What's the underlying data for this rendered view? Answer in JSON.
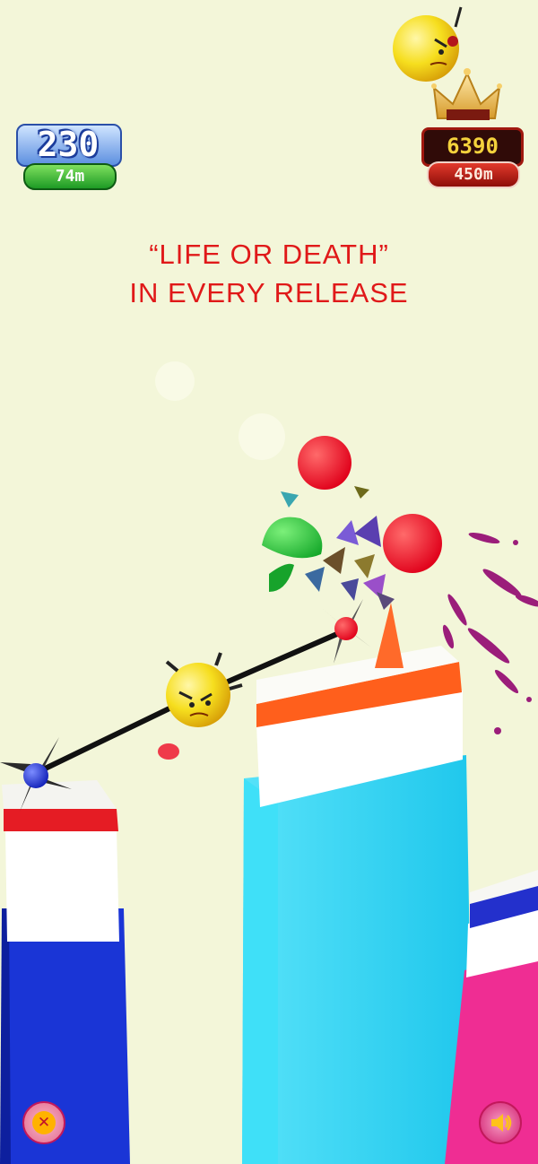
{
  "hud": {
    "score": "230",
    "distance": "74m",
    "best_score": "6390",
    "best_distance": "450m"
  },
  "headline": {
    "line1": "“LIFE OR DEATH”",
    "line2": "IN EVERY RELEASE"
  },
  "icons": {
    "exit": "close-icon",
    "sound": "speaker-icon",
    "crown": "crown-icon"
  },
  "colors": {
    "background": "#f3f6d9",
    "headline": "#e01919",
    "pillar_blue": "#1a35d6",
    "pillar_cyan": "#29d8f5",
    "pillar_pink": "#ef2d93"
  }
}
